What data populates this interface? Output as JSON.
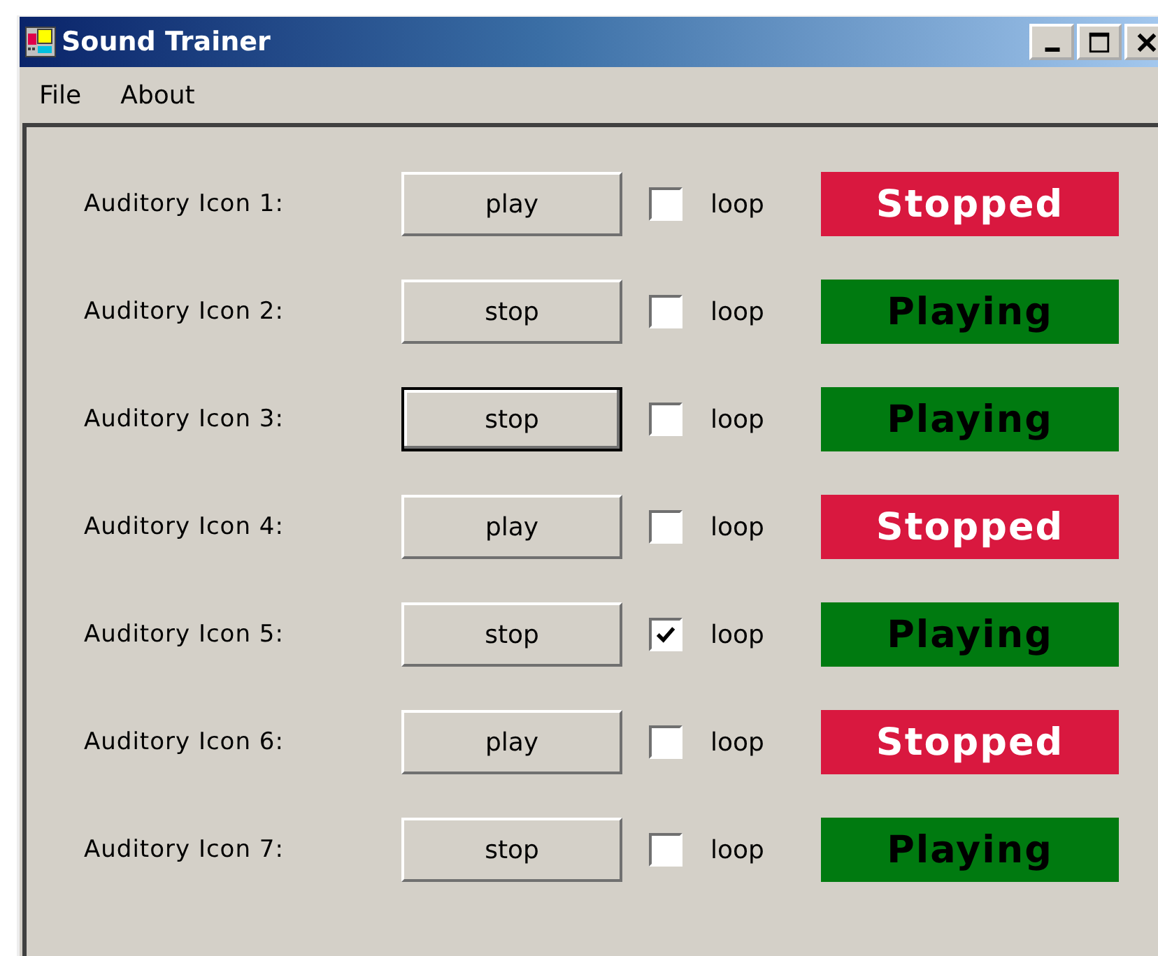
{
  "window": {
    "title": "Sound Trainer"
  },
  "menu": [
    "File",
    "About"
  ],
  "rows": [
    {
      "label": "Auditory Icon 1:",
      "button": "play",
      "focused": false,
      "loop_label": "loop",
      "loop": false,
      "status": {
        "kind": "stopped",
        "text": "Stopped"
      }
    },
    {
      "label": "Auditory Icon 2:",
      "button": "stop",
      "focused": false,
      "loop_label": "loop",
      "loop": false,
      "status": {
        "kind": "playing",
        "text": "Playing"
      }
    },
    {
      "label": "Auditory Icon 3:",
      "button": "stop",
      "focused": true,
      "loop_label": "loop",
      "loop": false,
      "status": {
        "kind": "playing",
        "text": "Playing"
      }
    },
    {
      "label": "Auditory Icon 4:",
      "button": "play",
      "focused": false,
      "loop_label": "loop",
      "loop": false,
      "status": {
        "kind": "stopped",
        "text": "Stopped"
      }
    },
    {
      "label": "Auditory Icon 5:",
      "button": "stop",
      "focused": false,
      "loop_label": "loop",
      "loop": true,
      "status": {
        "kind": "playing",
        "text": "Playing"
      }
    },
    {
      "label": "Auditory Icon 6:",
      "button": "play",
      "focused": false,
      "loop_label": "loop",
      "loop": false,
      "status": {
        "kind": "stopped",
        "text": "Stopped"
      }
    },
    {
      "label": "Auditory Icon 7:",
      "button": "stop",
      "focused": false,
      "loop_label": "loop",
      "loop": false,
      "status": {
        "kind": "playing",
        "text": "Playing"
      }
    }
  ]
}
